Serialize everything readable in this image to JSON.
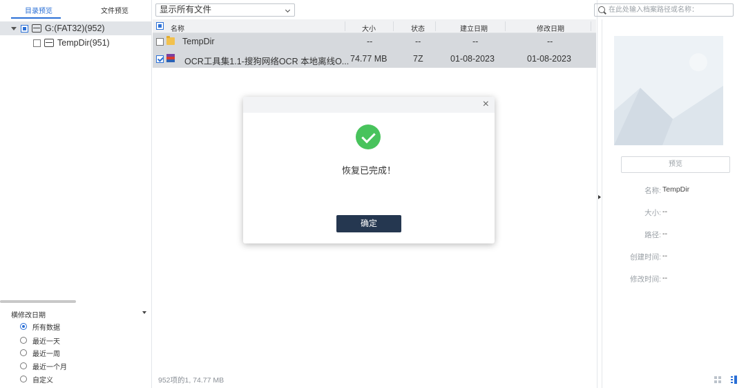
{
  "left_tabs": {
    "directory": "目录预览",
    "file": "文件预览"
  },
  "tree": {
    "root_label": "G:(FAT32)(952)",
    "child_label": "TempDir(951)"
  },
  "filter": {
    "title": "横修改日期",
    "options": [
      "所有数据",
      "最近一天",
      "最近一周",
      "最近一个月",
      "自定义"
    ],
    "selected": 0
  },
  "toolbar": {
    "filter_select": "显示所有文件"
  },
  "search": {
    "placeholder": "在此处输入档案路径或名称："
  },
  "table": {
    "headers": {
      "name": "名称",
      "size": "大小",
      "status": "状态",
      "created": "建立日期",
      "modified": "修改日期"
    },
    "rows": [
      {
        "name": "TempDir",
        "size": "--",
        "status": "--",
        "created": "--",
        "modified": "--",
        "checked": false,
        "icon": "folder-icon"
      },
      {
        "name": "OCR工具集1.1-搜狗网络OCR 本地离线O...",
        "size": "74.77  MB",
        "status": "7Z",
        "created": "01-08-2023",
        "modified": "01-08-2023",
        "checked": true,
        "icon": "rar-archive-icon"
      }
    ]
  },
  "status_bar": {
    "text": "952项的1, 74.77  MB"
  },
  "dialog": {
    "message": "恢复已完成！",
    "ok_label": "确定",
    "close_glyph": "×"
  },
  "preview": {
    "button_label": "预览",
    "fields": [
      {
        "label": "名称:",
        "value": "TempDir"
      },
      {
        "label": "大小:",
        "value": "--"
      },
      {
        "label": "路径:",
        "value": "--"
      },
      {
        "label": "创建时间:",
        "value": "--"
      },
      {
        "label": "修改时间:",
        "value": "--"
      }
    ]
  },
  "colors": {
    "accent": "#2a6fd6",
    "ok_button": "#253750",
    "success": "#48c35c",
    "row_selected": "#d6d9dd"
  }
}
